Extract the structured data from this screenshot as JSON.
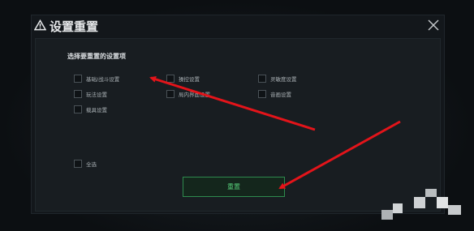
{
  "dialog": {
    "title": "设置重置",
    "section_title": "选择要重置的设置项",
    "options": [
      {
        "label": "基础/战斗设置",
        "checked": false
      },
      {
        "label": "操控设置",
        "checked": false
      },
      {
        "label": "灵敏度设置",
        "checked": false
      },
      {
        "label": "玩法设置",
        "checked": false
      },
      {
        "label": "局内界面设置",
        "checked": false
      },
      {
        "label": "音画设置",
        "checked": false
      },
      {
        "label": "载具设置",
        "checked": false
      }
    ],
    "select_all": "全选",
    "reset_button": "重置"
  },
  "colors": {
    "accent_green": "#57d07a",
    "annotation_arrow": "#e3141a"
  },
  "icons": {
    "title_icon": "warning-triangle-icon",
    "close": "close-icon"
  }
}
